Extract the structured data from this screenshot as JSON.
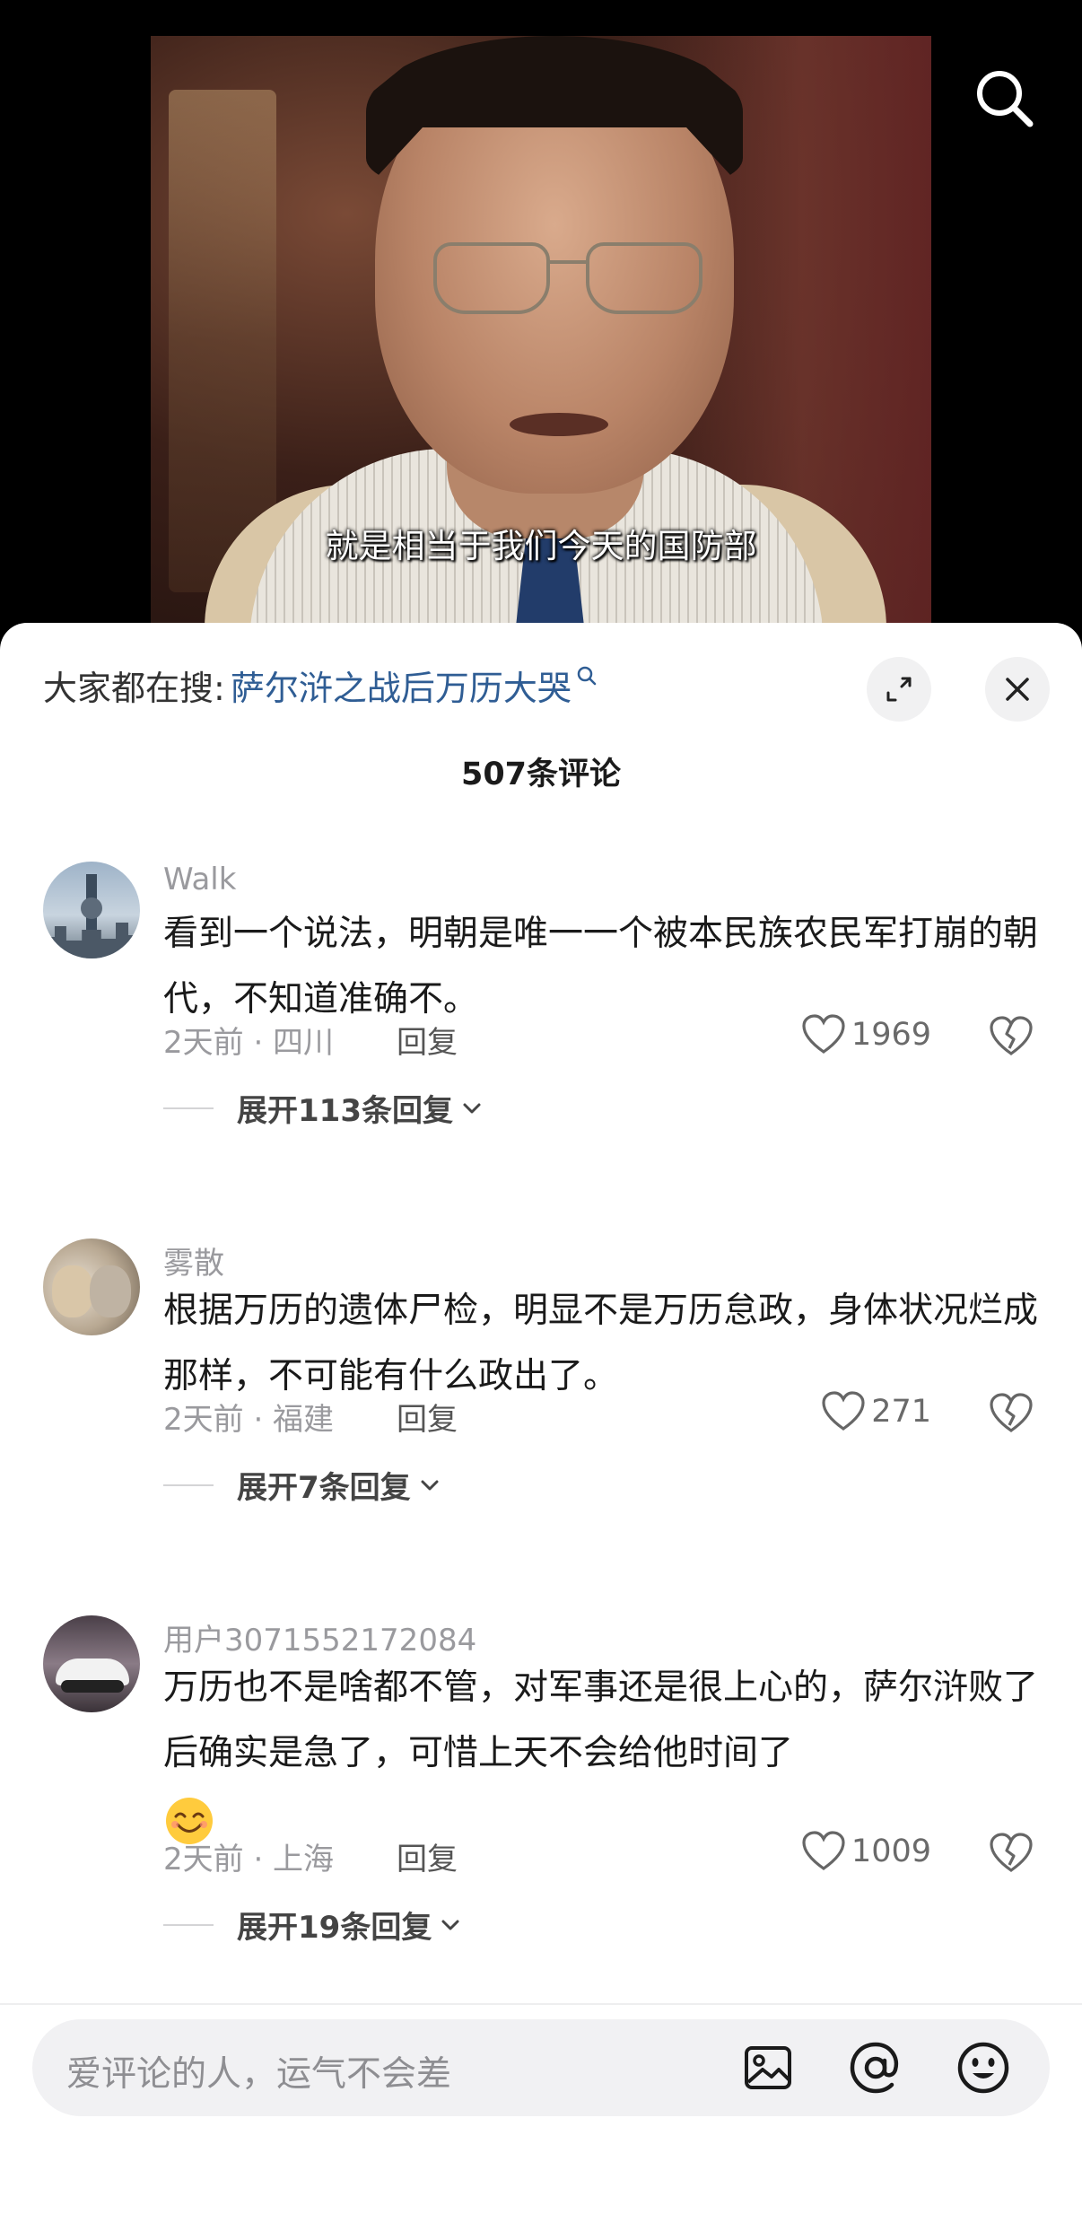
{
  "video": {
    "subtitle": "就是相当于我们今天的国防部"
  },
  "sheet": {
    "hot_prefix": "大家都在搜:",
    "hot_query": "萨尔浒之战后万历大哭",
    "comment_count": "507条评论"
  },
  "comments": [
    {
      "user": "Walk",
      "text": "看到一个说法，明朝是唯一一个被本民族农民军打崩的朝代，不知道准确不。",
      "meta": "2天前 · 四川",
      "reply": "回复",
      "likes": "1969",
      "expand": "展开113条回复"
    },
    {
      "user": "雾散",
      "text": "根据万历的遗体尸检，明显不是万历怠政，身体状况烂成那样，不可能有什么政出了。",
      "meta": "2天前 · 福建",
      "reply": "回复",
      "likes": "271",
      "expand": "展开7条回复"
    },
    {
      "user": "用户3071552172084",
      "text": "万历也不是啥都不管，对军事还是很上心的，萨尔浒败了后确实是急了，可惜上天不会给他时间了",
      "meta": "2天前 · 上海",
      "reply": "回复",
      "likes": "1009",
      "expand": "展开19条回复"
    }
  ],
  "input": {
    "placeholder": "爱评论的人，运气不会差"
  },
  "icons": {
    "top_right": "search-icon",
    "sheet_actions": [
      "expand-icon",
      "close-icon"
    ],
    "comment_actions": [
      "heart-icon",
      "broken-heart-icon",
      "chevron-down-icon"
    ],
    "input_actions": [
      "image-icon",
      "at-icon",
      "emoji-icon"
    ]
  },
  "colors": {
    "hot_query": "#2f5d94",
    "muted_text": "#9a9a9e",
    "input_bg": "#f1f1f3"
  }
}
